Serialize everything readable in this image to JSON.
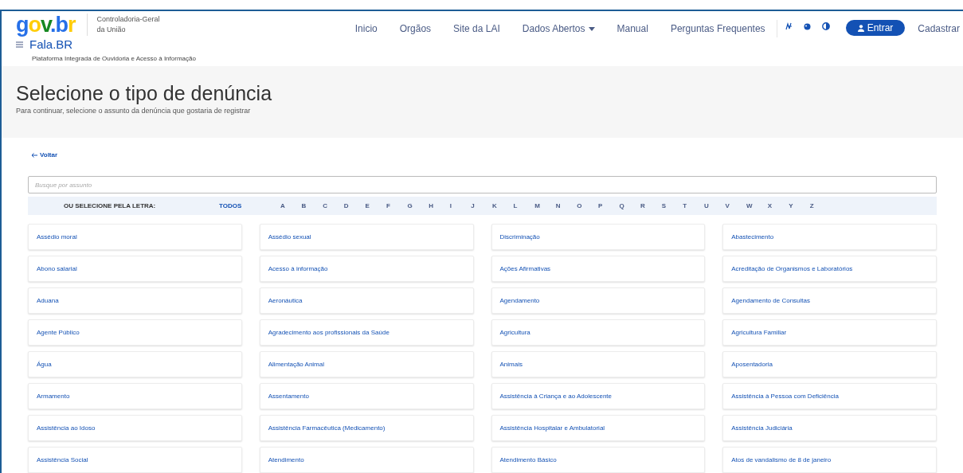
{
  "header": {
    "logo": "gov.br",
    "org": [
      "Controladoria-Geral",
      "da União"
    ],
    "app_name": "Fala.BR",
    "app_subtitle": "Plataforma Integrada de Ouvidoria e Acesso à Informação",
    "nav": [
      {
        "label": "Inicio",
        "kind": "link"
      },
      {
        "label": "Orgãos",
        "kind": "link"
      },
      {
        "label": "Site da LAI",
        "kind": "link"
      },
      {
        "label": "Dados Abertos",
        "kind": "dropdown"
      },
      {
        "label": "Manual",
        "kind": "link"
      },
      {
        "label": "Perguntas Frequentes",
        "kind": "link"
      }
    ],
    "login_button": "Entrar",
    "register_link": "Cadastrar"
  },
  "hero": {
    "title": "Selecione o tipo de denúncia",
    "subtitle": "Para continuar, selecione o assunto da denúncia que gostaria de registrar"
  },
  "back_link": "Voltar",
  "search": {
    "placeholder": "Busque por assunto"
  },
  "letter_bar": {
    "label": "OU SELECIONE PELA LETRA:",
    "all": "TODOS",
    "letters": [
      "A",
      "B",
      "C",
      "D",
      "E",
      "F",
      "G",
      "H",
      "I",
      "J",
      "K",
      "L",
      "M",
      "N",
      "O",
      "P",
      "Q",
      "R",
      "S",
      "T",
      "U",
      "V",
      "W",
      "X",
      "Y",
      "Z"
    ]
  },
  "subjects": [
    "Assédio moral",
    "Assédio sexual",
    "Discriminação",
    "Abastecimento",
    "Abono salarial",
    "Acesso à informação",
    "Ações Afirmativas",
    "Acreditação de Organismos e Laboratórios",
    "Aduana",
    "Aeronáutica",
    "Agendamento",
    "Agendamento de Consultas",
    "Agente Público",
    "Agradecimento aos profissionais da Saúde",
    "Agricultura",
    "Agricultura Familiar",
    "Água",
    "Alimentação Animal",
    "Animais",
    "Aposentadoria",
    "Armamento",
    "Assentamento",
    "Assistência à Criança e ao Adolescente",
    "Assistência à Pessoa com Deficiência",
    "Assistência ao Idoso",
    "Assistência Farmacêutica (Medicamento)",
    "Assistência Hospitalar e Ambulatorial",
    "Assistência Judiciária",
    "Assistência Social",
    "Atendimento",
    "Atendimento Básico",
    "Atos de vandalismo de 8 de janeiro"
  ]
}
